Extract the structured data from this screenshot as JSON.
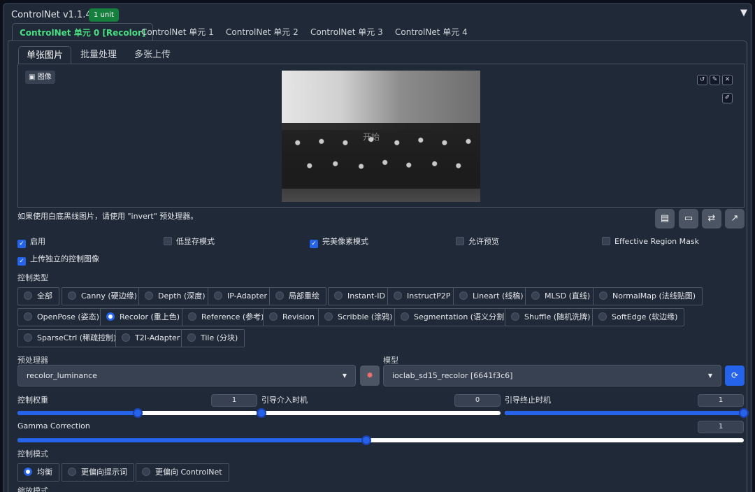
{
  "header": {
    "title": "ControlNet v1.1.449",
    "badge": "1 unit",
    "collapse_icon": "▼"
  },
  "unit_tabs": [
    {
      "label": "ControlNet 单元 0 [Recolor]",
      "active": true
    },
    {
      "label": "ControlNet 单元 1"
    },
    {
      "label": "ControlNet 单元 2"
    },
    {
      "label": "ControlNet 单元 3"
    },
    {
      "label": "ControlNet 单元 4"
    }
  ],
  "input_tabs": [
    {
      "label": "单张图片",
      "active": true
    },
    {
      "label": "批量处理"
    },
    {
      "label": "多张上传"
    }
  ],
  "image_panel": {
    "label": "图像",
    "overlay_text": "开始"
  },
  "hint": "如果使用白底黑线图片，请使用 \"invert\" 预处理器。",
  "checkboxes": {
    "enable": {
      "label": "启用",
      "checked": true
    },
    "lowvram": {
      "label": "低显存模式",
      "checked": false
    },
    "pixel_perfect": {
      "label": "完美像素模式",
      "checked": true
    },
    "allow_preview": {
      "label": "允许预览",
      "checked": false
    },
    "effective_mask": {
      "label": "Effective Region Mask",
      "checked": false
    },
    "upload_independent": {
      "label": "上传独立的控制图像",
      "checked": true
    }
  },
  "control_type": {
    "label": "控制类型",
    "options": [
      "全部",
      "Canny (硬边缘)",
      "Depth (深度)",
      "IP-Adapter",
      "局部重绘",
      "Instant-ID",
      "InstructP2P",
      "Lineart (线稿)",
      "MLSD (直线)",
      "NormalMap (法线贴图)",
      "OpenPose (姿态)",
      "Recolor (重上色)",
      "Reference (参考)",
      "Revision",
      "Scribble (涂鸦)",
      "Segmentation (语义分割)",
      "Shuffle (随机洗牌)",
      "SoftEdge (软边缘)",
      "SparseCtrl (稀疏控制)",
      "T2I-Adapter",
      "Tile (分块)"
    ],
    "selected": "Recolor (重上色)"
  },
  "preprocessor": {
    "label": "预处理器",
    "value": "recolor_luminance"
  },
  "model": {
    "label": "模型",
    "value": "ioclab_sd15_recolor [6641f3c6]"
  },
  "sliders": {
    "weight": {
      "label": "控制权重",
      "value": "1",
      "fraction": 0.5
    },
    "start": {
      "label": "引导介入时机",
      "value": "0",
      "fraction": 0.0
    },
    "end": {
      "label": "引导终止时机",
      "value": "1",
      "fraction": 1.0
    },
    "gamma": {
      "label": "Gamma Correction",
      "value": "1",
      "fraction": 0.48
    }
  },
  "control_mode": {
    "label": "控制模式",
    "options": [
      "均衡",
      "更偏向提示词",
      "更偏向 ControlNet"
    ],
    "selected": "均衡"
  },
  "resize_mode": {
    "label": "缩放模式"
  },
  "colors": {
    "accent": "#2563eb",
    "badge": "#15803d",
    "active_tab": "#4ade80"
  }
}
